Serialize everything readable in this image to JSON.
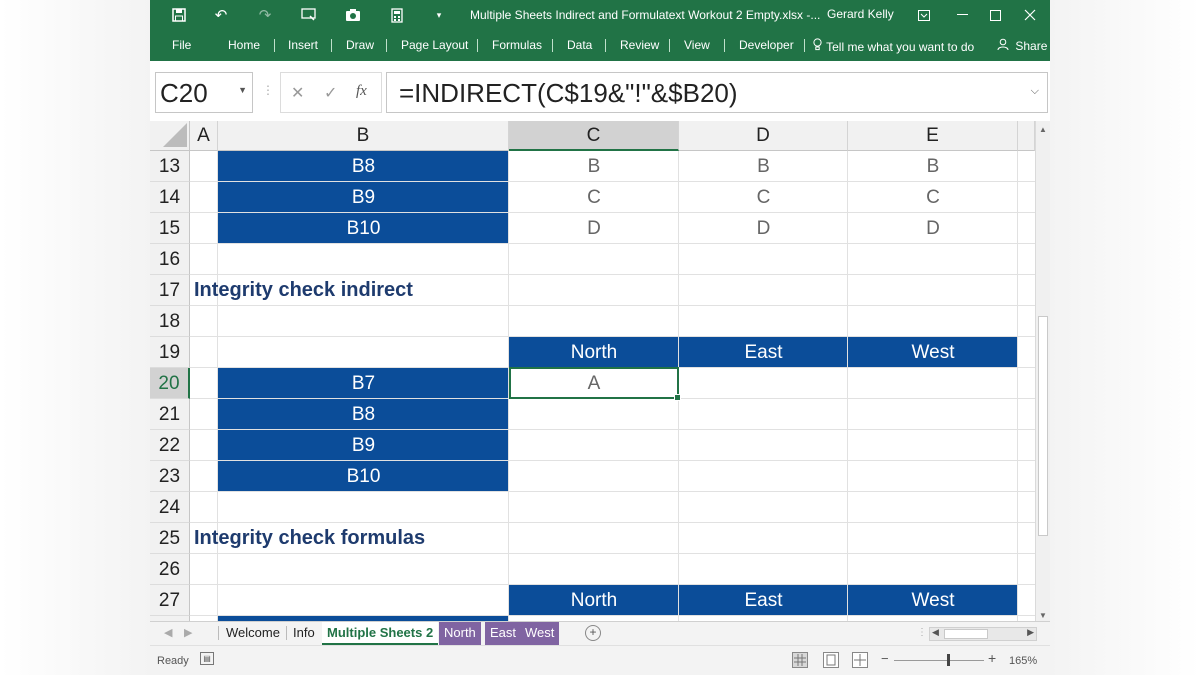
{
  "titlebar": {
    "title": "Multiple Sheets Indirect and Formulatext Workout 2 Empty.xlsx -...",
    "user": "Gerard Kelly",
    "icons": [
      "save-icon",
      "undo-icon",
      "redo-icon",
      "presentation-icon",
      "camera-icon",
      "calculator-icon",
      "customize-icon"
    ]
  },
  "ribbon": {
    "tabs": [
      "File",
      "Home",
      "Insert",
      "Draw",
      "Page Layout",
      "Formulas",
      "Data",
      "Review",
      "View",
      "Developer"
    ],
    "tell_me": "Tell me what you want to do",
    "share": "Share"
  },
  "formula_bar": {
    "name_box": "C20",
    "formula": "=INDIRECT(C$19&\"!\"&$B20)",
    "fx_label": "fx"
  },
  "grid": {
    "columns": [
      "A",
      "B",
      "C",
      "D",
      "E"
    ],
    "selected_column": "C",
    "rows": [
      "13",
      "14",
      "15",
      "16",
      "17",
      "18",
      "19",
      "20",
      "21",
      "22",
      "23",
      "24",
      "25",
      "26",
      "27"
    ],
    "selected_row": "20",
    "cells": {
      "b13": "B8",
      "b14": "B9",
      "b15": "B10",
      "c13": "B",
      "c14": "C",
      "c15": "D",
      "d13": "B",
      "d14": "C",
      "d15": "D",
      "e13": "B",
      "e14": "C",
      "e15": "D",
      "a17": "Integrity check indirect",
      "c19": "North",
      "d19": "East",
      "e19": "West",
      "b20": "B7",
      "c20": "A",
      "b21": "B8",
      "b22": "B9",
      "b23": "B10",
      "a25": "Integrity check formulas",
      "c27": "North",
      "d27": "East",
      "e27": "West"
    },
    "header_fill": "#0b4d99",
    "accent": "#217346"
  },
  "sheet_tabs": {
    "tabs": [
      "Welcome",
      "Info",
      "Multiple Sheets 2",
      "North",
      "East",
      "West"
    ],
    "active": "Multiple Sheets 2",
    "tab_color_purple": "#8064a2"
  },
  "status_bar": {
    "ready": "Ready",
    "zoom": "165%"
  }
}
